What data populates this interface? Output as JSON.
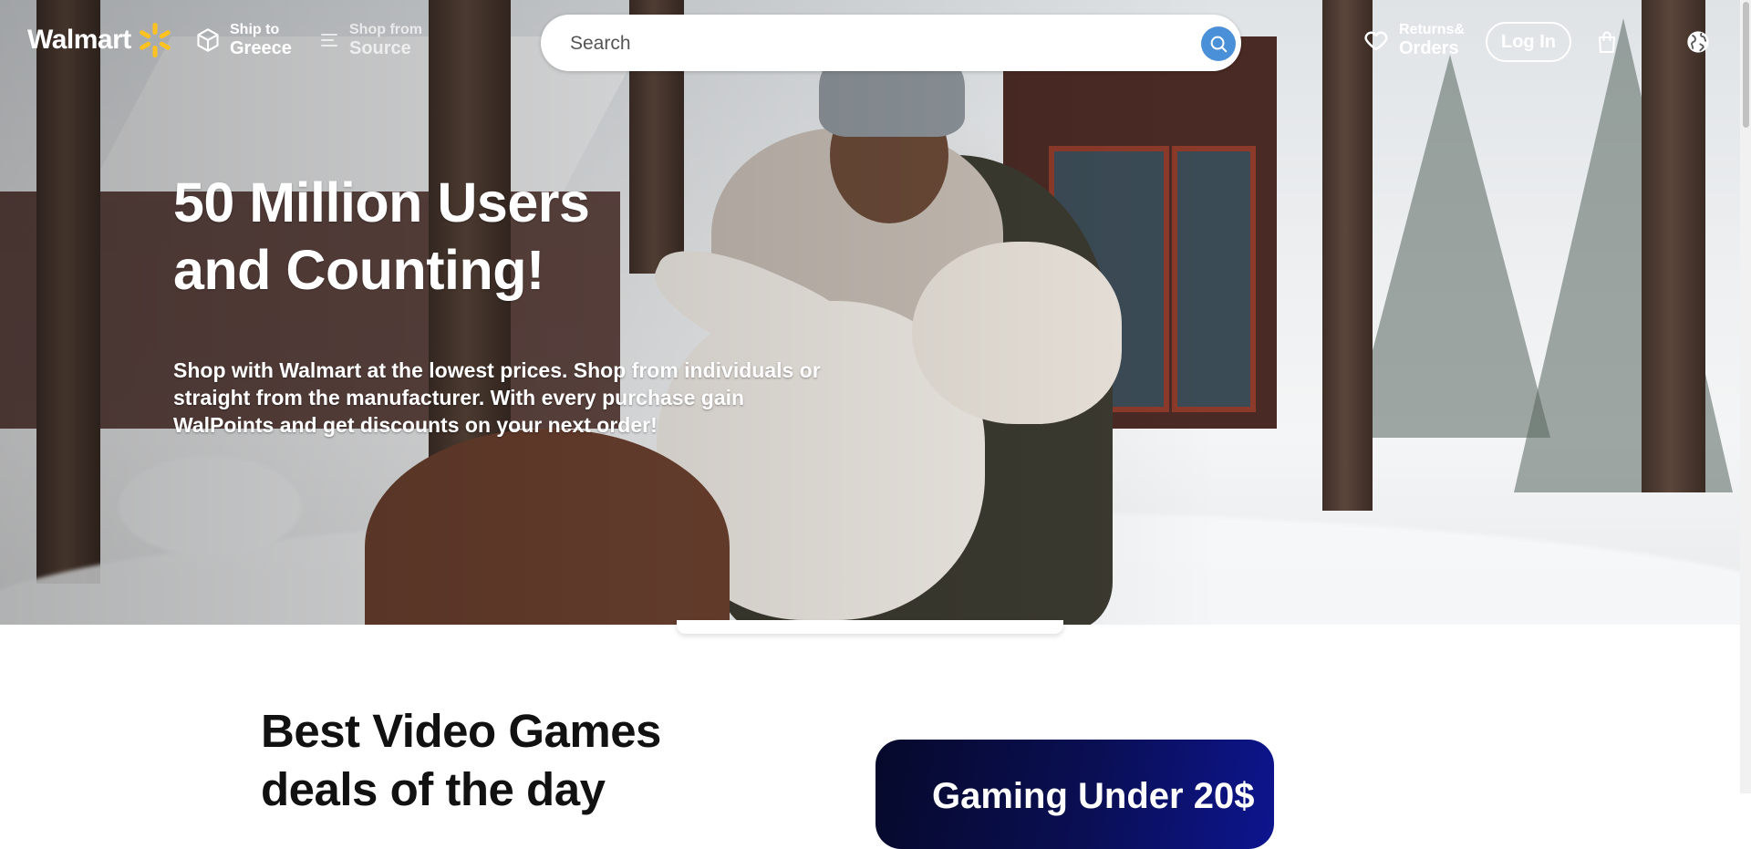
{
  "header": {
    "logo": "Walmart",
    "ship_to": {
      "label": "Ship to",
      "value": "Greece"
    },
    "shop_from": {
      "label": "Shop from",
      "value": "Source"
    },
    "search": {
      "placeholder": "Search"
    },
    "returns": {
      "label": "Returns&",
      "value": "Orders"
    },
    "login_label": "Log In"
  },
  "hero": {
    "title": "50 Million Users and Counting!",
    "text": "Shop with Walmart at the lowest prices. Shop from individuals or straight from the manufacturer. With every purchase gain WalPoints and get discounts on your next order!"
  },
  "section": {
    "title": "Best Video Games deals of the day",
    "promo_label": "Gaming Under 20$"
  },
  "colors": {
    "spark": "#ffc220",
    "search_button": "#4a90d9",
    "promo_dark": "#06092a",
    "promo_light": "#0d158f"
  }
}
